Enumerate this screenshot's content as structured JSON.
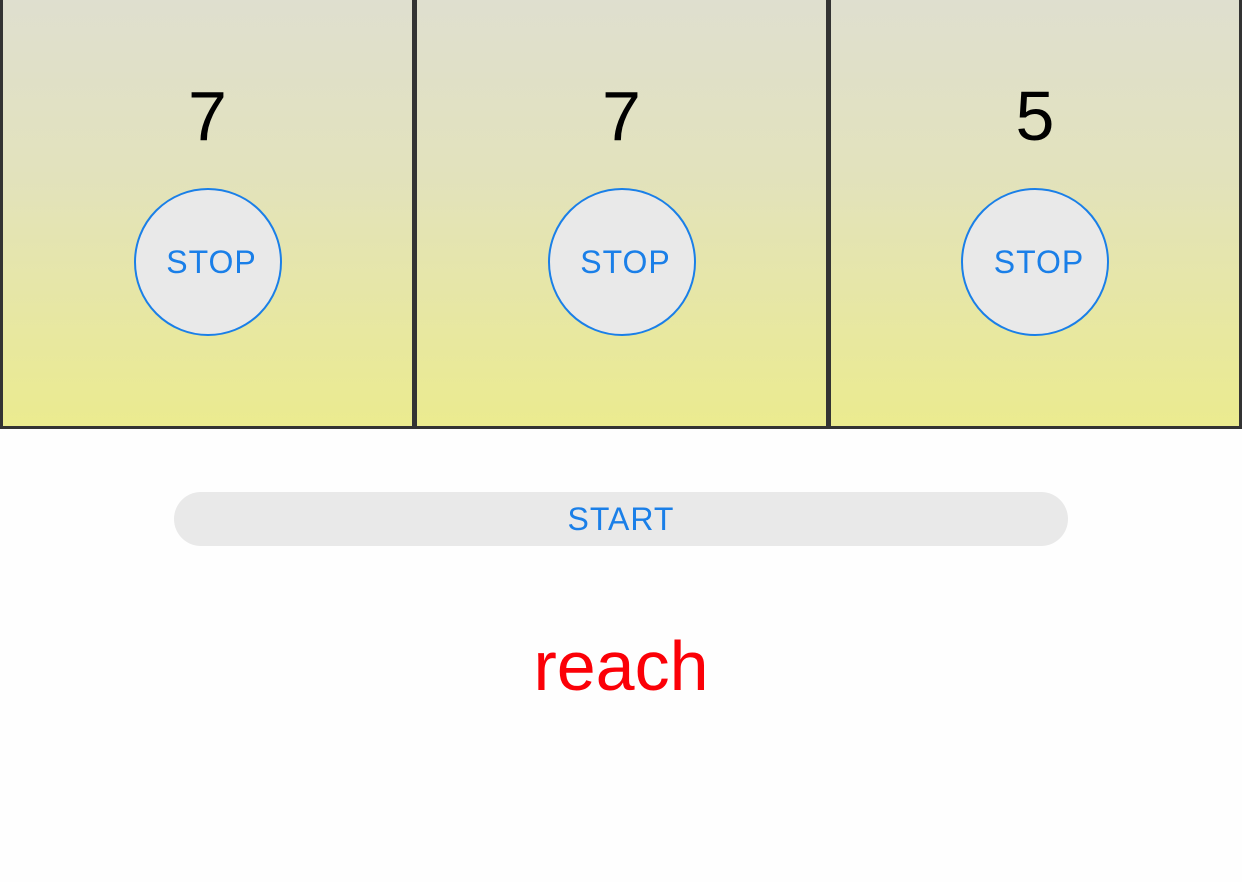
{
  "reels": [
    {
      "number": "7",
      "stop_label": "STOP"
    },
    {
      "number": "7",
      "stop_label": "STOP"
    },
    {
      "number": "5",
      "stop_label": "STOP"
    }
  ],
  "start_label": "START",
  "result_text": "reach",
  "colors": {
    "accent": "#1a7fe8",
    "result": "#fb0007",
    "button_bg": "#e9e9e9",
    "divider": "#333333",
    "reel_gradient_top": "#dfdfcf",
    "reel_gradient_bottom": "#ebeb8f"
  }
}
